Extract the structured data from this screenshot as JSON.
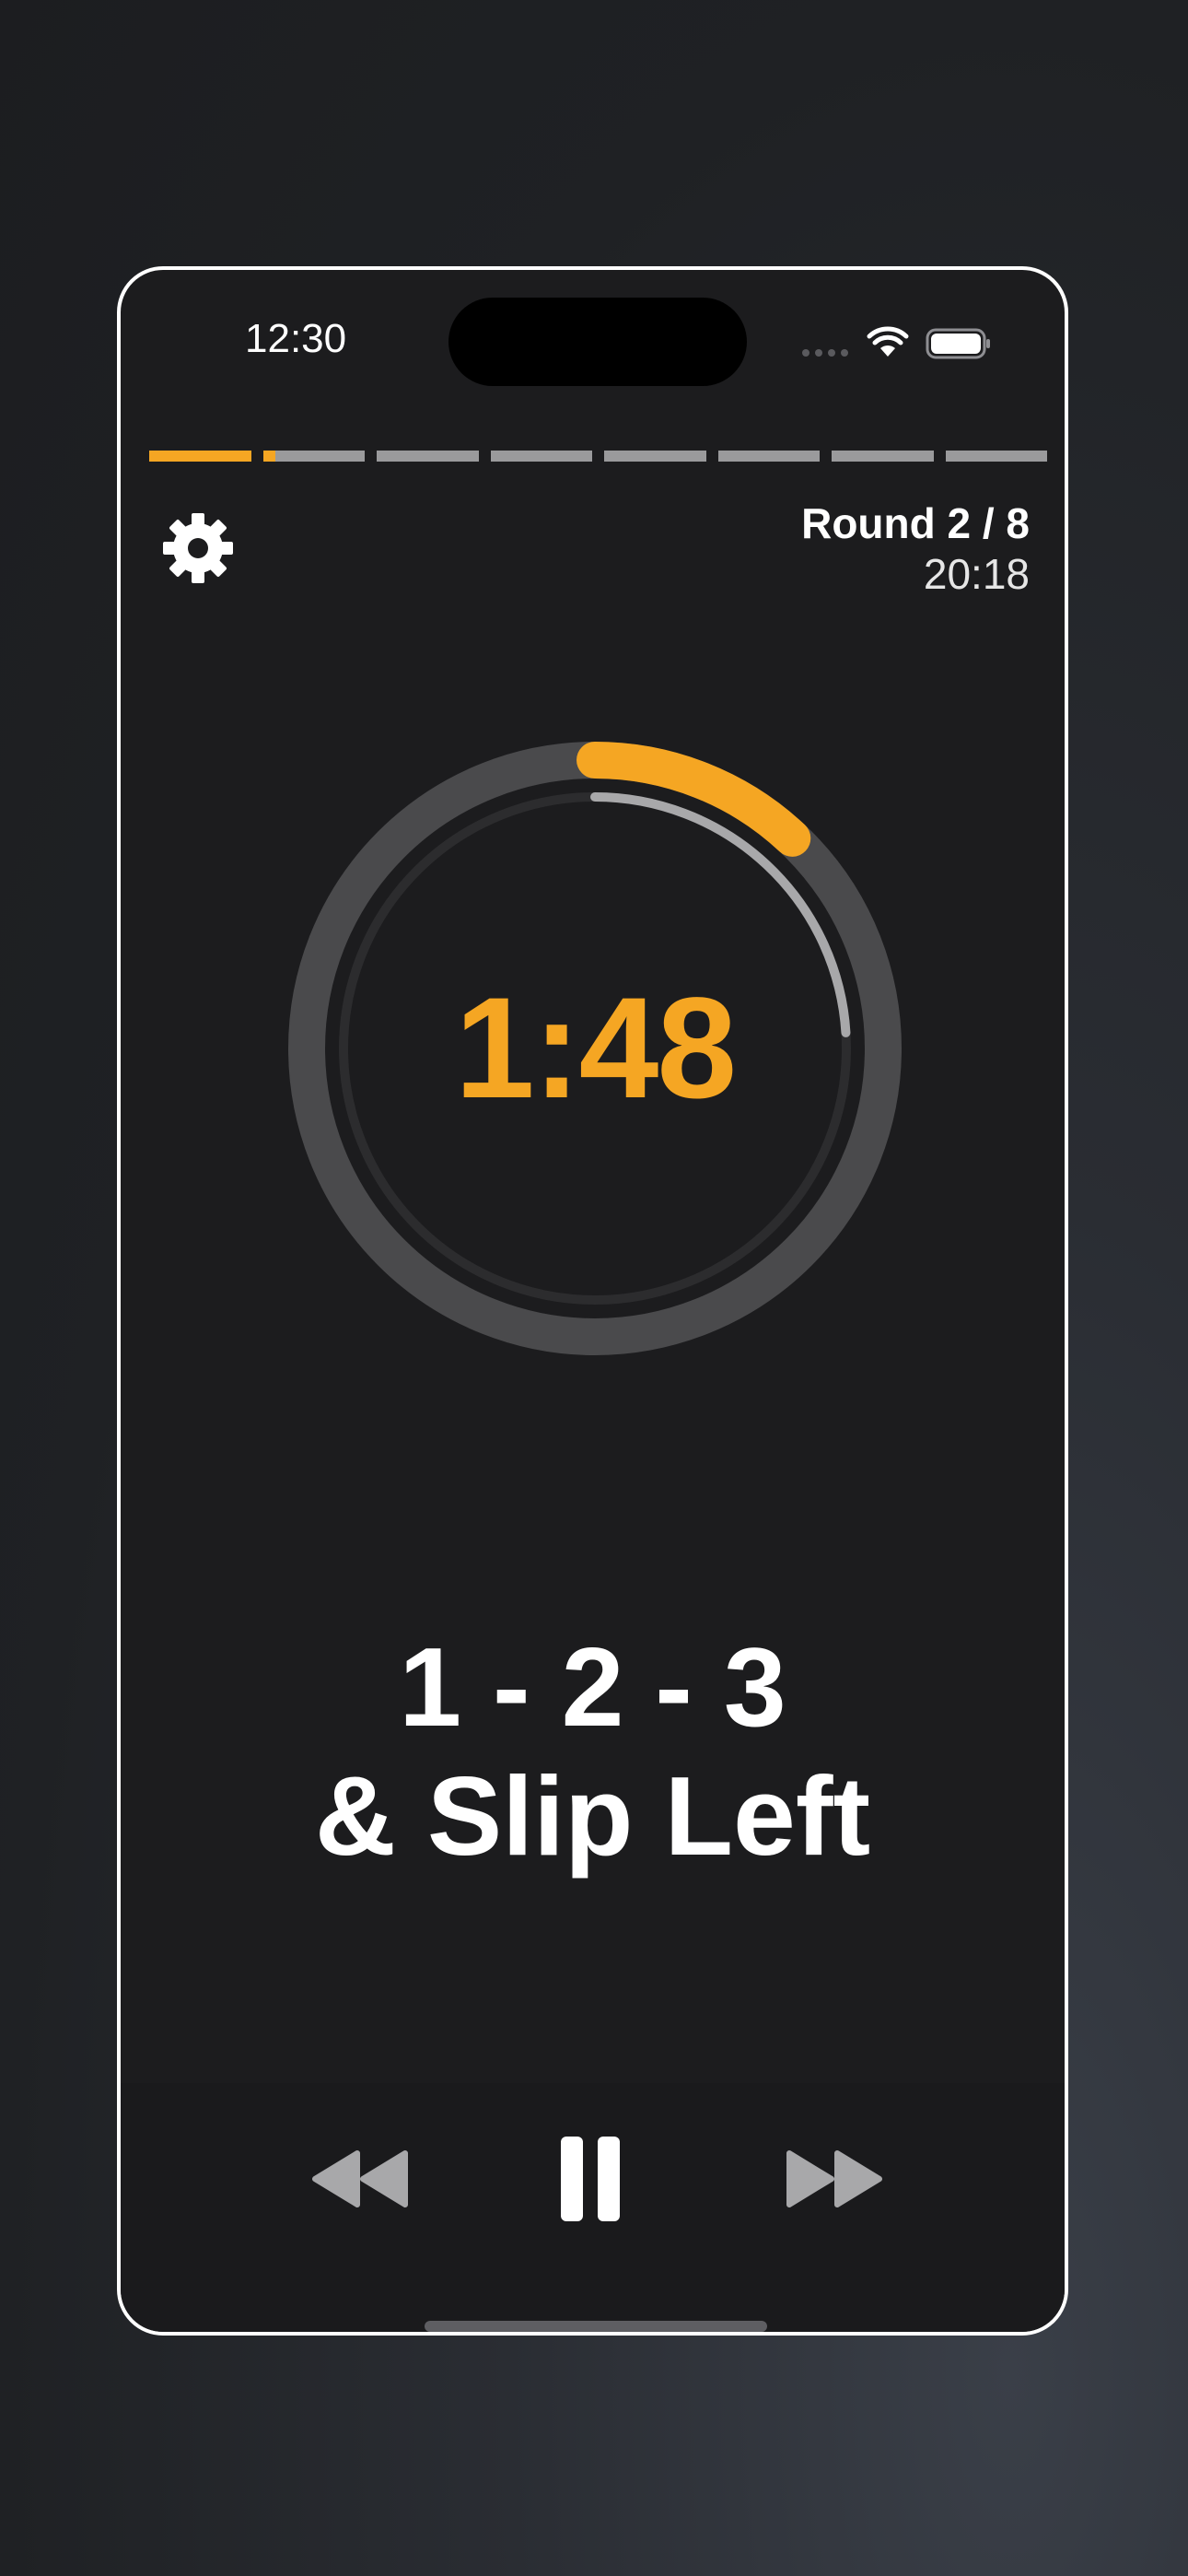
{
  "status_bar": {
    "time": "12:30",
    "icons": [
      "signal-icon",
      "wifi-icon",
      "battery-icon"
    ]
  },
  "round_progress": {
    "total_rounds": 8,
    "segments_fill": [
      1,
      0.12,
      0,
      0,
      0,
      0,
      0,
      0
    ]
  },
  "header": {
    "settings_icon": "gear-icon",
    "round_label": "Round 2 / 8",
    "total_time": "20:18"
  },
  "timer": {
    "time_remaining": "1:48",
    "outer_ring_progress": 0.12,
    "inner_ring_progress": 0.24
  },
  "combo": {
    "line1": "1 - 2 - 3",
    "line2": "& Slip Left"
  },
  "controls": {
    "rewind_icon": "rewind-icon",
    "pause_icon": "pause-icon",
    "forward_icon": "fast-forward-icon"
  },
  "colors": {
    "accent": "#f5a623",
    "background": "#1c1c1e",
    "inactive": "#9a9a9c",
    "ring_track": "#4a4a4c"
  }
}
